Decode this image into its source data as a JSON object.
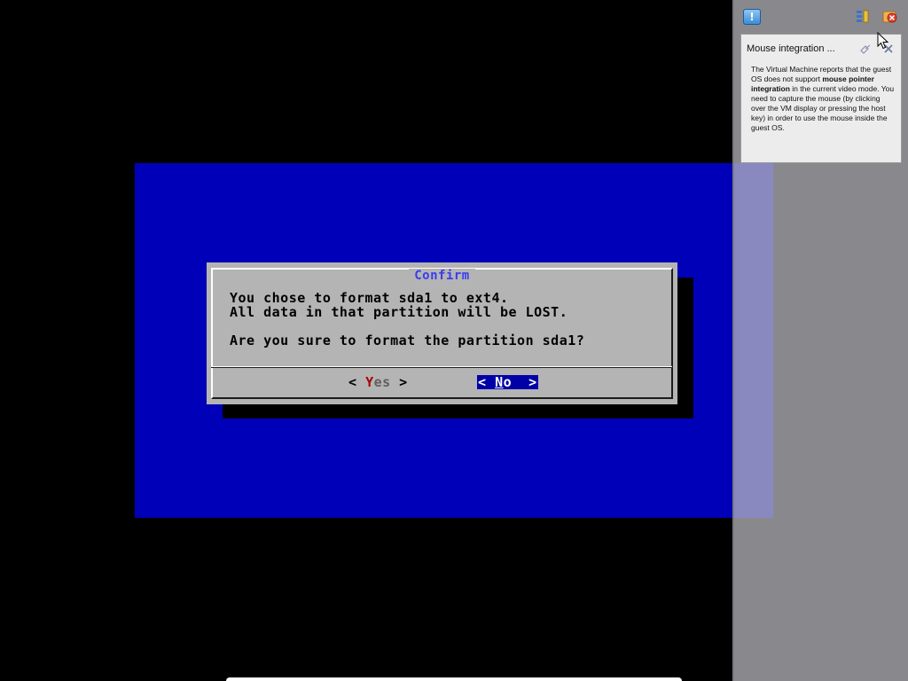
{
  "dialog": {
    "title": "Confirm",
    "line1": "You chose to format sda1 to ext4.",
    "line2": "All data in that partition will be LOST.",
    "line3": "Are you sure to format the partition sda1?",
    "yes_button": {
      "left": "< ",
      "hotkey": "Y",
      "rest": "es",
      "right": " >"
    },
    "no_button": {
      "left": "< ",
      "hotkey": "N",
      "rest": "o",
      "right": "  >"
    }
  },
  "side_panel": {
    "icons": [
      "notification-icon",
      "details-icon",
      "close-all-icon"
    ],
    "popup": {
      "title": "Mouse integration ...",
      "body_part1": "The Virtual Machine reports that the guest OS does not support ",
      "body_bold1": "mouse pointer integration",
      "body_part2": " in the current video mode. You need to capture the mouse (by clicking over the VM display or pressing the host key) in order to use the mouse inside the guest OS."
    }
  },
  "colors": {
    "backdrop_blue": "#0000b8",
    "dialog_gray": "#b4b4b4",
    "title_blue": "#3b3bf0",
    "hotkey_red": "#a80000",
    "selected_button_bg": "#0000a8"
  }
}
